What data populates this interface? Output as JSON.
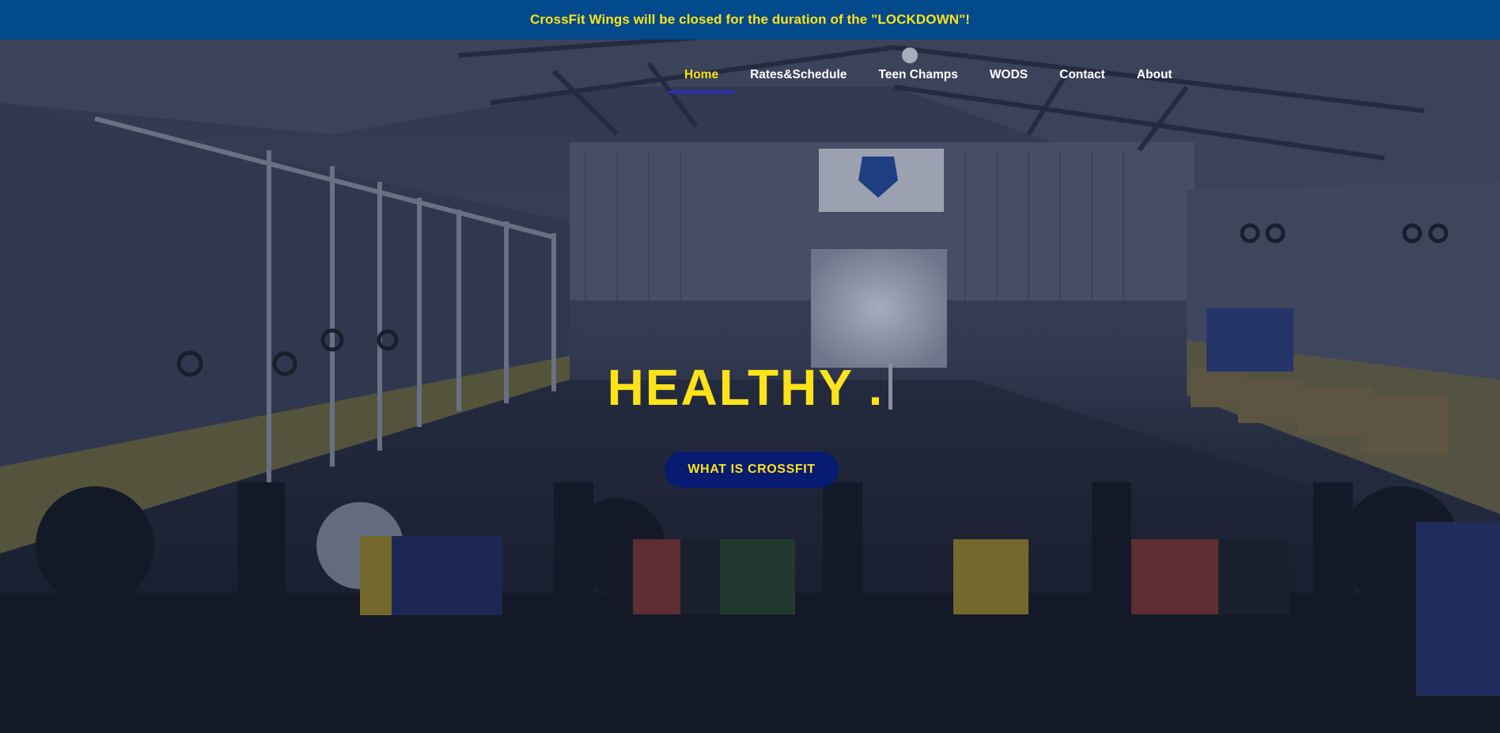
{
  "announcement": {
    "text": "CrossFit Wings will be closed for the duration of the \"LOCKDOWN\"!"
  },
  "nav": {
    "items": [
      {
        "label": "Home",
        "active": true
      },
      {
        "label": "Rates&Schedule",
        "active": false
      },
      {
        "label": "Teen Champs",
        "active": false
      },
      {
        "label": "WODS",
        "active": false
      },
      {
        "label": "Contact",
        "active": false
      },
      {
        "label": "About",
        "active": false
      }
    ]
  },
  "hero": {
    "headline": "HEALTHY .",
    "cta_label": "WHAT IS CROSSFIT"
  },
  "colors": {
    "announcement_bg": "#034a8c",
    "accent_yellow": "#ffe31a",
    "cta_bg": "#071b72",
    "nav_underline": "#2a2bd6"
  }
}
